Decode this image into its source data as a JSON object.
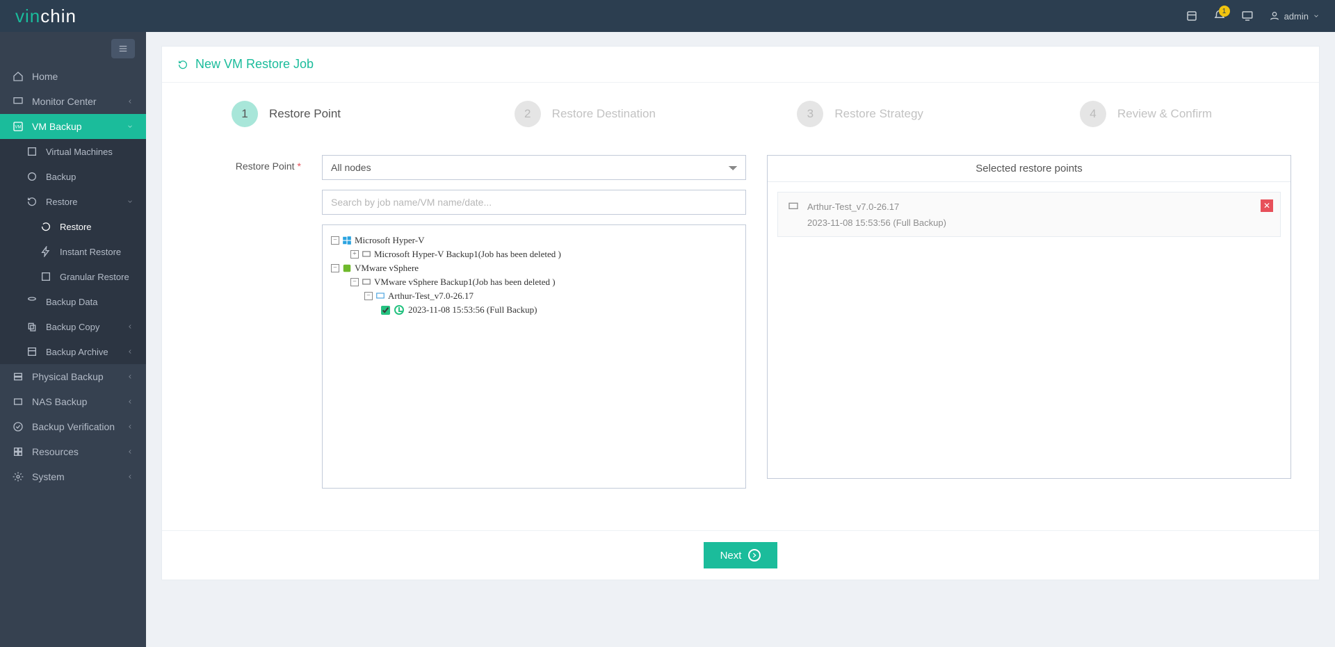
{
  "brand": {
    "part1": "vin",
    "part2": "chin"
  },
  "top": {
    "notif_count": "1",
    "username": "admin"
  },
  "sidebar": {
    "home": "Home",
    "monitor": "Monitor Center",
    "vm_backup": "VM Backup",
    "vm_backup_sub": {
      "virtual_machines": "Virtual Machines",
      "backup": "Backup",
      "restore": "Restore",
      "restore_sub": {
        "restore": "Restore",
        "instant": "Instant Restore",
        "granular": "Granular Restore"
      },
      "backup_data": "Backup Data",
      "backup_copy": "Backup Copy",
      "backup_archive": "Backup Archive"
    },
    "physical_backup": "Physical Backup",
    "nas_backup": "NAS Backup",
    "backup_verification": "Backup Verification",
    "resources": "Resources",
    "system": "System"
  },
  "panel": {
    "title": "New VM Restore Job",
    "steps": {
      "s1": "Restore Point",
      "s2": "Restore Destination",
      "s3": "Restore Strategy",
      "s4": "Review & Confirm",
      "n1": "1",
      "n2": "2",
      "n3": "3",
      "n4": "4"
    },
    "form": {
      "label": "Restore Point",
      "node_select": "All nodes",
      "search_placeholder": "Search by job name/VM name/date..."
    },
    "tree": {
      "hyperv": "Microsoft Hyper-V",
      "hyperv_job": "Microsoft Hyper-V Backup1(Job has been deleted )",
      "vsphere": "VMware vSphere",
      "vsphere_job": "VMware vSphere Backup1(Job has been deleted )",
      "vm": "Arthur-Test_v7.0-26.17",
      "point": "2023-11-08 15:53:56 (Full  Backup)"
    },
    "right": {
      "title": "Selected restore points",
      "sel_vm": "Arthur-Test_v7.0-26.17",
      "sel_point": "2023-11-08 15:53:56 (Full Backup)"
    },
    "next": "Next"
  }
}
